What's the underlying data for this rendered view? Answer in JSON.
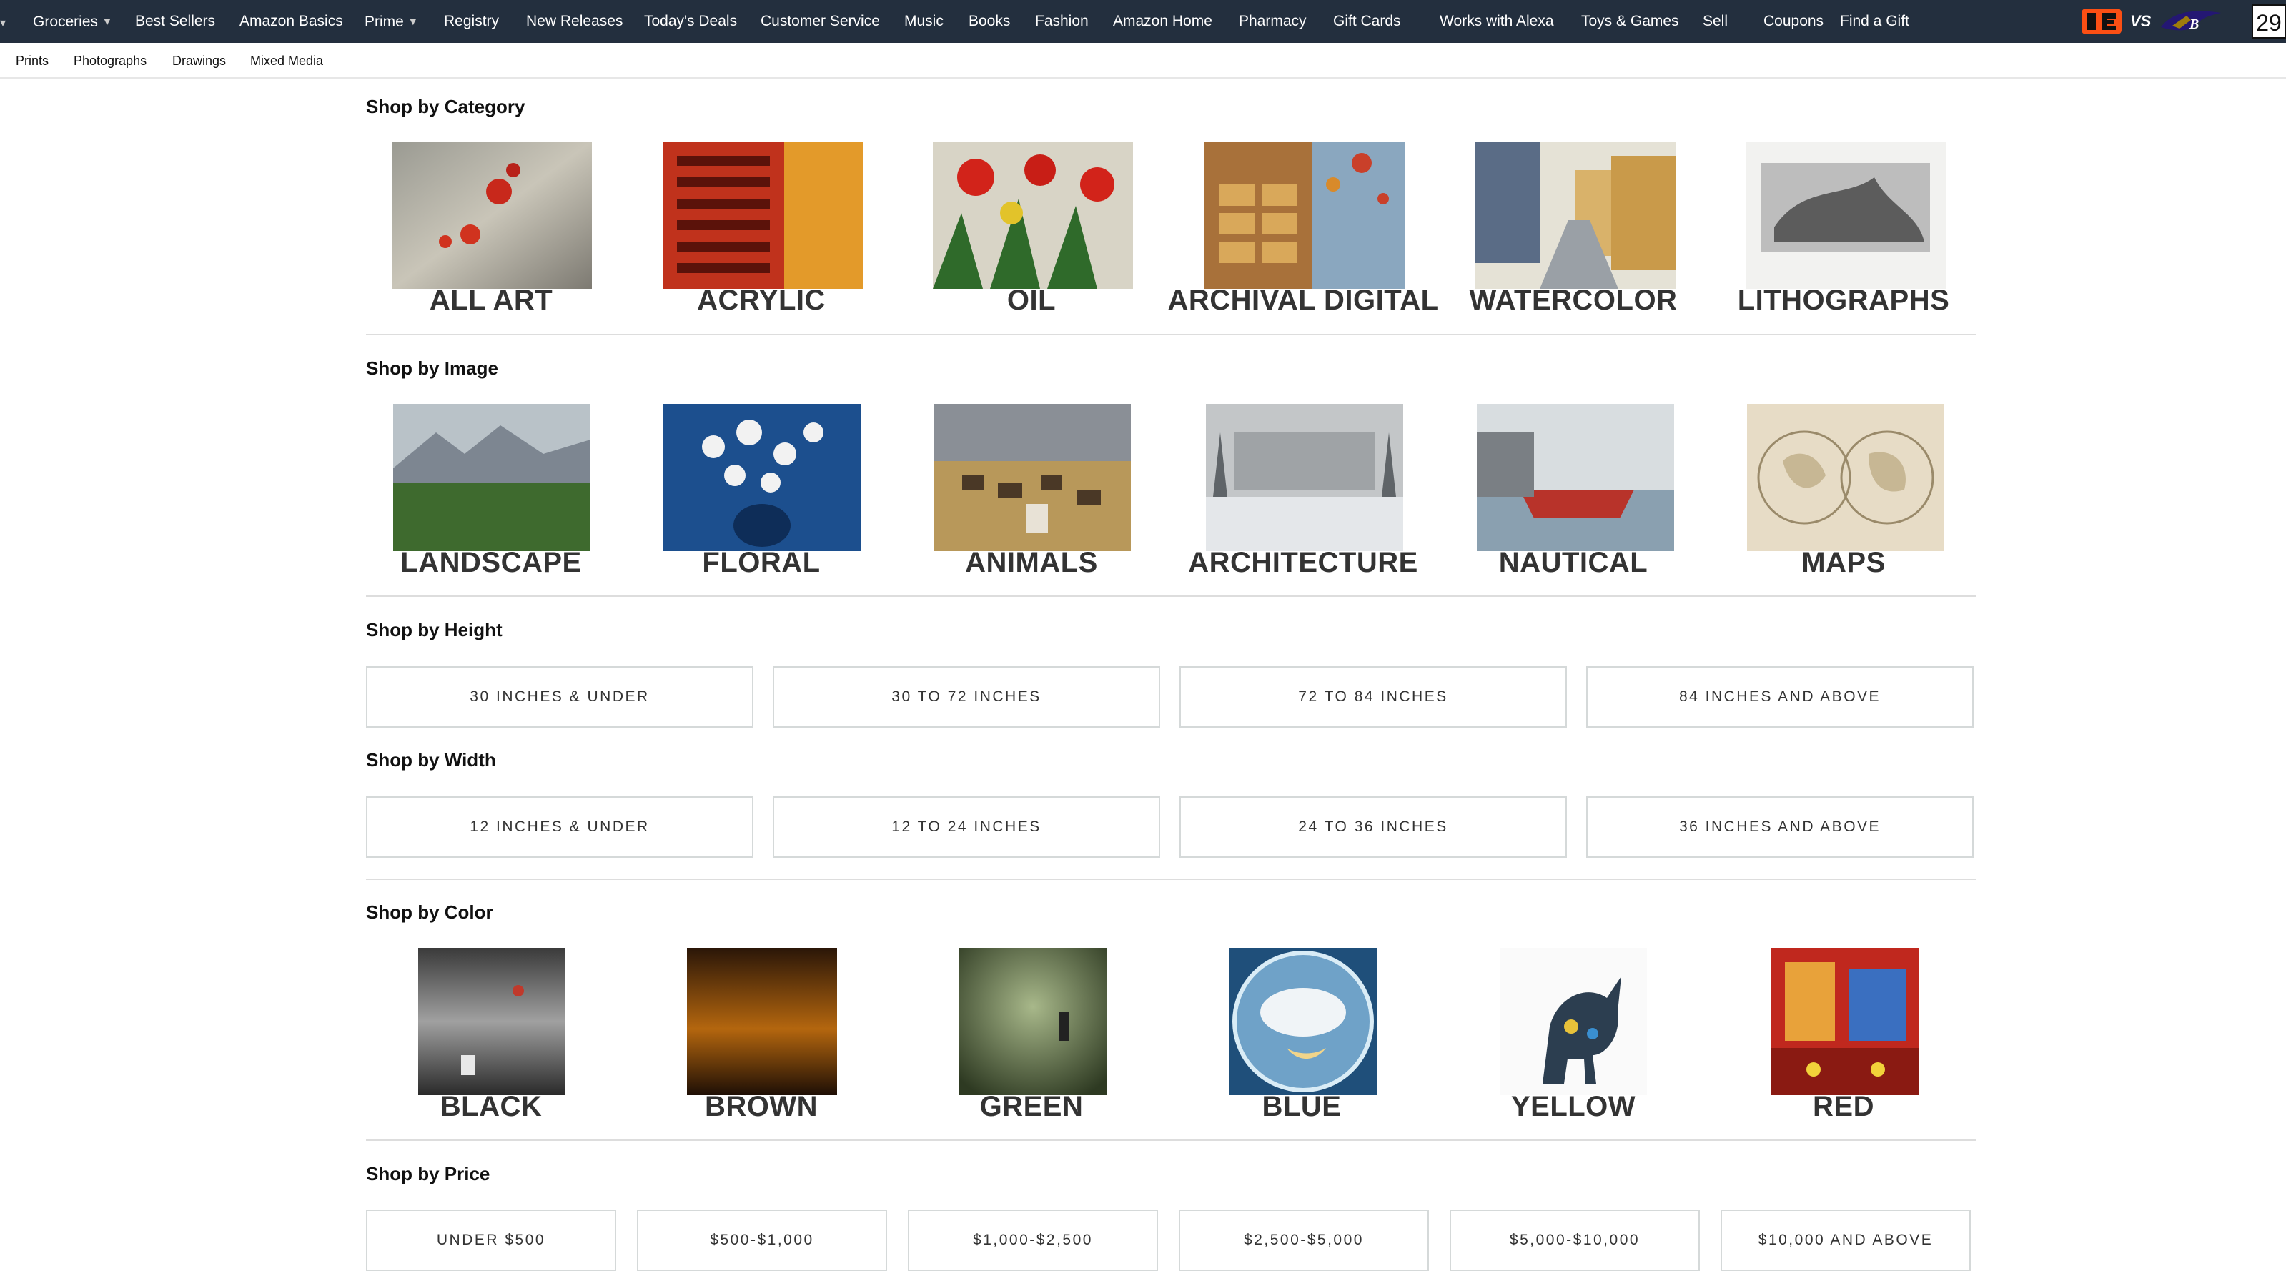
{
  "nav": {
    "items": [
      {
        "label": "Groceries",
        "caret": true
      },
      {
        "label": "Best Sellers"
      },
      {
        "label": "Amazon Basics"
      },
      {
        "label": "Prime",
        "caret": true
      },
      {
        "label": "Registry"
      },
      {
        "label": "New Releases"
      },
      {
        "label": "Today's Deals"
      },
      {
        "label": "Customer Service"
      },
      {
        "label": "Music"
      },
      {
        "label": "Books"
      },
      {
        "label": "Fashion"
      },
      {
        "label": "Amazon Home"
      },
      {
        "label": "Pharmacy"
      },
      {
        "label": "Gift Cards"
      },
      {
        "label": "Works with Alexa"
      },
      {
        "label": "Toys & Games"
      },
      {
        "label": "Sell"
      },
      {
        "label": "Coupons"
      },
      {
        "label": "Find a Gift"
      }
    ],
    "promo": {
      "vs": "VS",
      "count": "29",
      "team1": "bengals-logo",
      "team2": "ravens-logo"
    }
  },
  "subnav": {
    "items": [
      "Prints",
      "Photographs",
      "Drawings",
      "Mixed Media"
    ]
  },
  "sections": {
    "category": {
      "title": "Shop by Category",
      "tiles": [
        {
          "label": "ALL ART"
        },
        {
          "label": "ACRYLIC"
        },
        {
          "label": "OIL"
        },
        {
          "label": "ARCHIVAL DIGITAL"
        },
        {
          "label": "WATERCOLOR"
        },
        {
          "label": "LITHOGRAPHS"
        }
      ]
    },
    "image": {
      "title": "Shop by Image",
      "tiles": [
        {
          "label": "LANDSCAPE"
        },
        {
          "label": "FLORAL"
        },
        {
          "label": "ANIMALS"
        },
        {
          "label": "ARCHITECTURE"
        },
        {
          "label": "NAUTICAL"
        },
        {
          "label": "MAPS"
        }
      ]
    },
    "height": {
      "title": "Shop by Height",
      "buttons": [
        "30 INCHES & UNDER",
        "30 TO 72 INCHES",
        "72 TO 84 INCHES",
        "84 INCHES AND ABOVE"
      ]
    },
    "width": {
      "title": "Shop by Width",
      "buttons": [
        "12 INCHES & UNDER",
        "12 TO 24 INCHES",
        "24 TO 36 INCHES",
        "36 INCHES AND ABOVE"
      ]
    },
    "color": {
      "title": "Shop by Color",
      "tiles": [
        {
          "label": "BLACK"
        },
        {
          "label": "BROWN"
        },
        {
          "label": "GREEN"
        },
        {
          "label": "BLUE"
        },
        {
          "label": "YELLOW"
        },
        {
          "label": "RED"
        }
      ]
    },
    "price": {
      "title": "Shop by Price",
      "buttons": [
        "UNDER $500",
        "$500-$1,000",
        "$1,000-$2,500",
        "$2,500-$5,000",
        "$5,000-$10,000",
        "$10,000 AND ABOVE"
      ]
    }
  },
  "colors": {
    "nav_bg": "#232f3e",
    "border": "#d5d9d9",
    "divider": "#dddddd"
  }
}
